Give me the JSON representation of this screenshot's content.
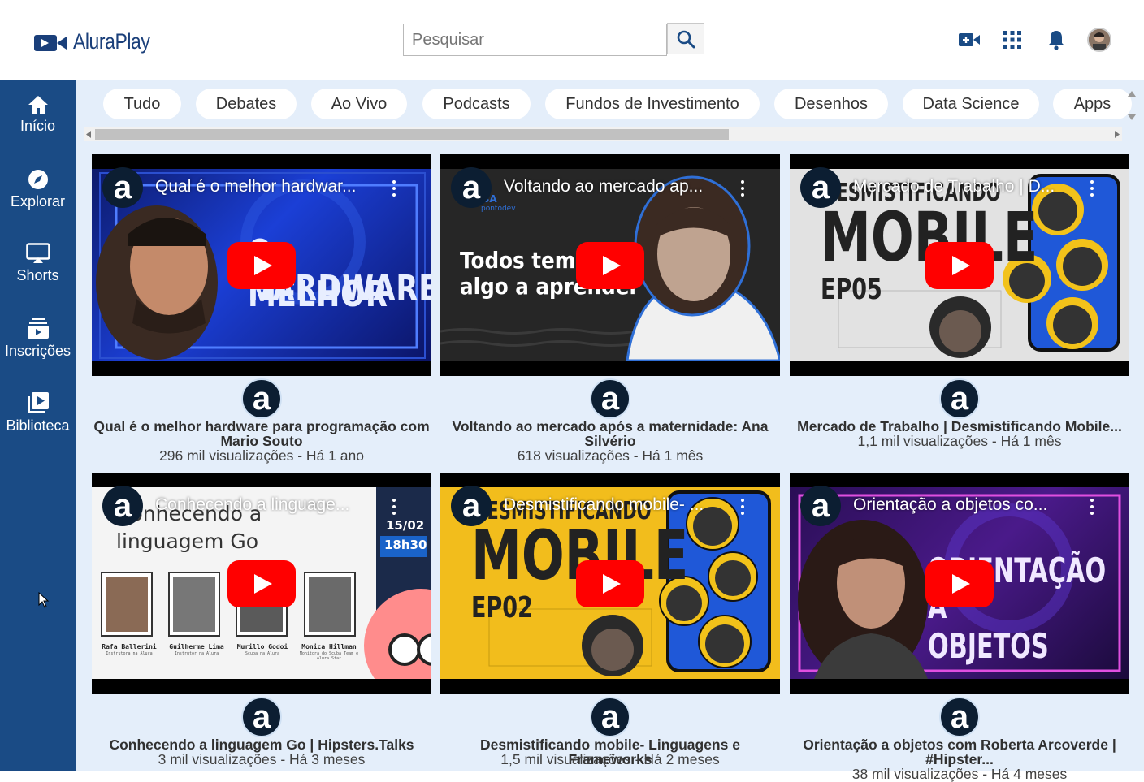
{
  "app": {
    "logo_text": "AluraPlay",
    "brand_color": "#1a4b85"
  },
  "search": {
    "placeholder": "Pesquisar",
    "button_icon": "search-icon"
  },
  "header_icons": [
    "video-add-icon",
    "apps-grid-icon",
    "bell-icon",
    "user-avatar"
  ],
  "sidebar": {
    "items": [
      {
        "label": "Início",
        "icon": "home-icon"
      },
      {
        "label": "Explorar",
        "icon": "compass-icon"
      },
      {
        "label": "Shorts",
        "icon": "shorts-icon"
      },
      {
        "label": "Inscrições",
        "icon": "subscriptions-icon"
      },
      {
        "label": "Biblioteca",
        "icon": "library-icon"
      }
    ]
  },
  "categories": [
    "Tudo",
    "Debates",
    "Ao Vivo",
    "Podcasts",
    "Fundos de Investimento",
    "Desenhos",
    "Data Science",
    "Apps"
  ],
  "channel_letter": "a",
  "videos": [
    {
      "overlay_title": "Qual é o melhor hardwar...",
      "thumb_text_1": "O MELHOR",
      "thumb_text_2": "HARDWARE",
      "title_line_1": "Qual é o melhor hardware para programação com",
      "title_line_2": "Mario Souto",
      "meta": "296 mil visualizações - Há 1 ano"
    },
    {
      "overlay_title": "Voltando ao mercado ap...",
      "thumb_text_1": "Todos tem",
      "thumb_text_2": "algo a aprender",
      "thumb_small": "SCUBA",
      "thumb_small_2": "pontodev",
      "title_line_1": "Voltando ao mercado após a maternidade: Ana",
      "title_line_2": "Silvério",
      "meta": "618 visualizações - Há 1 mês"
    },
    {
      "overlay_title": "Mercado de Trabalho | D...",
      "thumb_text_1": "DESMISTIFICANDO",
      "thumb_text_2": "MOBILE",
      "thumb_text_3": "EP05",
      "title_line_1": "Mercado de Trabalho | Desmistificando Mobile...",
      "title_line_2": "",
      "meta": "1,1 mil visualizações - Há 1 mês"
    },
    {
      "overlay_title": "Conhecendo a linguage...",
      "thumb_text_1": "Conhecendo a",
      "thumb_text_2": "linguagem Go",
      "thumb_date": "15/02",
      "thumb_time": "18h30",
      "people": [
        {
          "name": "Rafa Ballerini",
          "role": "Instrutora na Alura"
        },
        {
          "name": "Guilherme Lima",
          "role": "Instrutor na Alura"
        },
        {
          "name": "Murillo Godoi",
          "role": "Scuba na Alura"
        },
        {
          "name": "Monica Hillman",
          "role": "Monitora do Scuba Team e Alura Star"
        }
      ],
      "title_line_1": "Conhecendo a linguagem Go | Hipsters.Talks",
      "title_line_2": "",
      "meta": "3 mil visualizações - Há 3 meses"
    },
    {
      "overlay_title": "Desmistificando mobile- ...",
      "thumb_text_1": "DESMISTIFICANDO",
      "thumb_text_2": "MOBILE",
      "thumb_text_3": "EP02",
      "title_line_1": "Desmistificando mobile- Linguagens e Frameworks",
      "title_line_2": "",
      "meta": "1,5 mil visualizações - Há 2 meses"
    },
    {
      "overlay_title": "Orientação a objetos co...",
      "thumb_text_1": "ORIENTAÇÃO",
      "thumb_text_2": "A OBJETOS",
      "title_line_1": "Orientação a objetos com Roberta Arcoverde |",
      "title_line_2": "#Hipster...",
      "meta": "38 mil visualizações - Há 4 meses"
    }
  ]
}
